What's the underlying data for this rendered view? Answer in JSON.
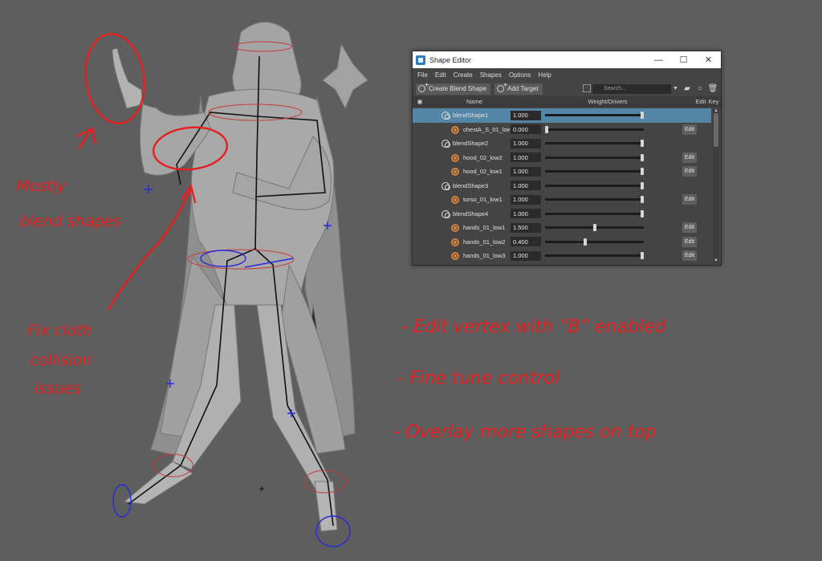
{
  "annotations": {
    "left_top": [
      "Mostly",
      "blend shapes"
    ],
    "left_mid": [
      "Fix cloth",
      "collision",
      "issues"
    ],
    "notes": [
      "- Edit vertex with “B” enabled",
      "- Fine tune control",
      "- Overlay more shapes on top"
    ],
    "color": "#e51f1f"
  },
  "shape_editor": {
    "title": "Shape Editor",
    "window_controls": [
      "—",
      "☐",
      "✕"
    ],
    "menu": [
      "File",
      "Edit",
      "Create",
      "Shapes",
      "Options",
      "Help"
    ],
    "toolbar": {
      "create_blend_shape": "Create Blend Shape",
      "add_target": "Add Target",
      "search_placeholder": "Search..."
    },
    "columns": {
      "name": "Name",
      "weight": "Weight/Drivers",
      "edit": "Edit",
      "key": "Key"
    },
    "rows": [
      {
        "type": "blendshape",
        "name": "blendShape1",
        "value": "1.000",
        "weight": 1.0,
        "edit": "",
        "selected": true
      },
      {
        "type": "target",
        "name": "chestA_S_01_low",
        "value": "0.000",
        "weight": 0.0,
        "edit": "Edit",
        "selected": false
      },
      {
        "type": "blendshape",
        "name": "blendShape2",
        "value": "1.000",
        "weight": 1.0,
        "edit": "",
        "selected": false
      },
      {
        "type": "target",
        "name": "hood_02_low2",
        "value": "1.000",
        "weight": 1.0,
        "edit": "Edit",
        "selected": false
      },
      {
        "type": "target",
        "name": "hood_02_low1",
        "value": "1.000",
        "weight": 1.0,
        "edit": "Edit",
        "selected": false
      },
      {
        "type": "blendshape",
        "name": "blendShape3",
        "value": "1.000",
        "weight": 1.0,
        "edit": "",
        "selected": false
      },
      {
        "type": "target",
        "name": "torso_01_low1",
        "value": "1.000",
        "weight": 1.0,
        "edit": "Edit",
        "selected": false
      },
      {
        "type": "blendshape",
        "name": "blendShape4",
        "value": "1.000",
        "weight": 1.0,
        "edit": "",
        "selected": false
      },
      {
        "type": "target",
        "name": "hands_01_low1",
        "value": "1.500",
        "weight": 0.5,
        "edit": "Edit",
        "selected": false
      },
      {
        "type": "target",
        "name": "hands_01_low2",
        "value": "0.400",
        "weight": 0.4,
        "edit": "Edit",
        "selected": false
      },
      {
        "type": "target",
        "name": "hands_01_low3",
        "value": "1.000",
        "weight": 1.0,
        "edit": "Edit",
        "selected": false
      }
    ]
  }
}
